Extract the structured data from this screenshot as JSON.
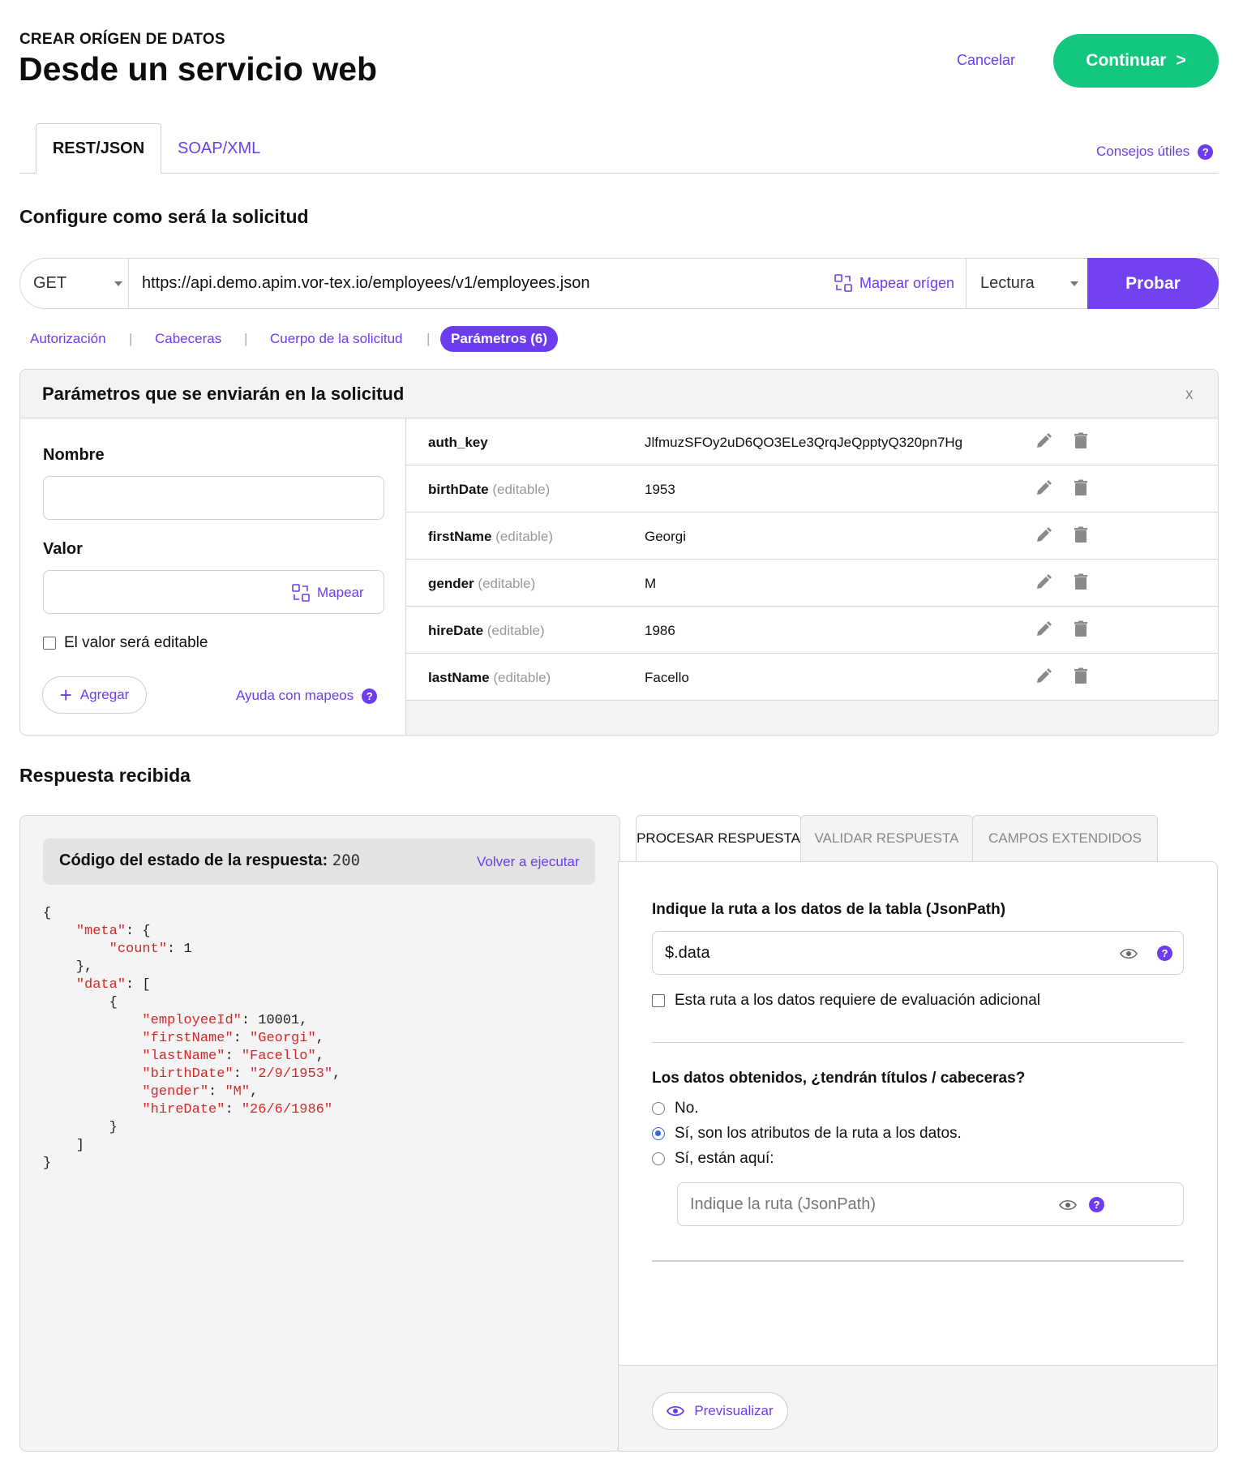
{
  "header": {
    "eyebrow": "CREAR ORÍGEN DE DATOS",
    "title": "Desde un servicio web",
    "cancel_label": "Cancelar",
    "continue_label": "Continuar",
    "continue_arrow": ">"
  },
  "tabs": {
    "rest": "REST/JSON",
    "soap": "SOAP/XML",
    "tips": "Consejos útiles",
    "help_icon": "?"
  },
  "request": {
    "section_title": "Configure como será la solicitud",
    "method": "GET",
    "url": "https://api.demo.apim.vor-tex.io/employees/v1/employees.json",
    "map_origin_label": "Mapear orígen",
    "mode": "Lectura",
    "test_label": "Probar",
    "subtabs": [
      "Autorización",
      "Cabeceras",
      "Cuerpo de la solicitud",
      "Parámetros (6)"
    ],
    "separator": "|"
  },
  "params": {
    "title": "Parámetros que se enviarán en la solicitud",
    "close": "x",
    "name_label": "Nombre",
    "value_label": "Valor",
    "map_label": "Mapear",
    "editable_checkbox_label": "El valor será editable",
    "add_label": "Agregar",
    "add_icon": "+",
    "help_map_label": "Ayuda con mapeos",
    "editable_suffix": "(editable)",
    "rows": [
      {
        "name": "auth_key",
        "editable": "",
        "value": "JlfmuzSFOy2uD6QO3ELe3QrqJeQpptyQ320pn7Hg"
      },
      {
        "name": "birthDate",
        "editable": "(editable)",
        "value": "1953"
      },
      {
        "name": "firstName",
        "editable": "(editable)",
        "value": "Georgi"
      },
      {
        "name": "gender",
        "editable": "(editable)",
        "value": "M"
      },
      {
        "name": "hireDate",
        "editable": "(editable)",
        "value": "1986"
      },
      {
        "name": "lastName",
        "editable": "(editable)",
        "value": "Facello"
      }
    ]
  },
  "response": {
    "section_title": "Respuesta recibida",
    "status_label": "Código del estado de la respuesta:",
    "status_code": "200",
    "rerun_label": "Volver a ejecutar",
    "json_lines": [
      "{",
      "    \"meta\": {",
      "        \"count\": 1",
      "    },",
      "    \"data\": [",
      "        {",
      "            \"employeeId\": 10001,",
      "            \"firstName\": \"Georgi\",",
      "            \"lastName\": \"Facello\",",
      "            \"birthDate\": \"2/9/1953\",",
      "            \"gender\": \"M\",",
      "            \"hireDate\": \"26/6/1986\"",
      "        }",
      "    ]",
      "}"
    ]
  },
  "processing": {
    "tabs": [
      "PROCESAR RESPUESTA",
      "VALIDAR RESPUESTA",
      "CAMPOS EXTENDIDOS"
    ],
    "jsonpath_label": "Indique la ruta a los datos de la tabla (JsonPath)",
    "jsonpath_value": "$.data",
    "extra_eval_label": "Esta ruta a los datos requiere de evaluación adicional",
    "headers_question": "Los datos obtenidos, ¿tendrán títulos / cabeceras?",
    "options": [
      "No.",
      "Sí, son los atributos de la ruta a los datos.",
      "Sí, están aquí:"
    ],
    "selected_option": 1,
    "headers_path_placeholder": "Indique la ruta (JsonPath)",
    "preview_label": "Previsualizar"
  },
  "colors": {
    "accent": "#6c3cf0",
    "primary_button": "#7241f0",
    "continue_button": "#14c77f",
    "json_key": "#d02a2a"
  },
  "icons": [
    "map-icon",
    "caret-down-icon",
    "pencil-icon",
    "trash-icon",
    "plus-icon",
    "help-icon",
    "eye-icon",
    "close-icon"
  ]
}
